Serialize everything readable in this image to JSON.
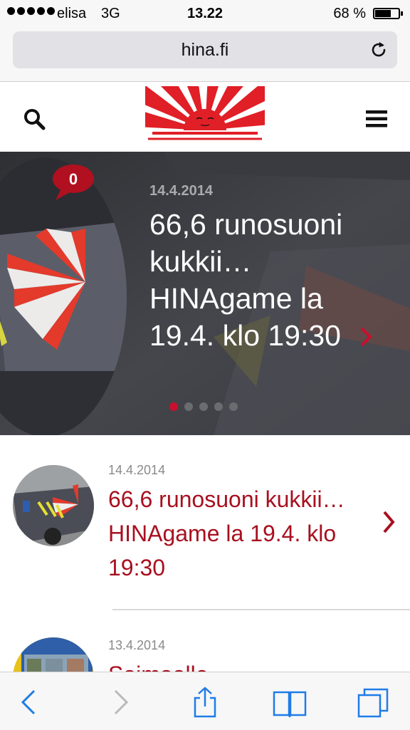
{
  "status_bar": {
    "carrier": "elisa",
    "network": "3G",
    "time": "13.22",
    "battery_percent": "68 %",
    "battery_level": 0.68,
    "signal_bars": 5
  },
  "browser": {
    "url": "hina.fi"
  },
  "header": {
    "logo_icon": "rising-sun-logo",
    "search_icon": "search-icon",
    "menu_icon": "hamburger-menu-icon"
  },
  "hero": {
    "comment_count": "0",
    "date": "14.4.2014",
    "title": "66,6 runosuoni kukkii… HINAgame la 19.4. klo 19:30",
    "slide_count": 5,
    "active_slide": 1
  },
  "list": [
    {
      "date": "14.4.2014",
      "title": "66,6 runosuoni kukkii… HINAgame la 19.4. klo 19:30"
    },
    {
      "date": "13.4.2014",
      "title": "Saimaalle"
    }
  ],
  "toolbar": {
    "back_icon": "back-chevron-icon",
    "forward_icon": "forward-chevron-icon",
    "share_icon": "share-icon",
    "bookmarks_icon": "book-icon",
    "tabs_icon": "tabs-icon"
  },
  "colors": {
    "accent_red": "#c8102e",
    "link_red": "#a8101f",
    "ios_blue": "#1f7ce8"
  }
}
